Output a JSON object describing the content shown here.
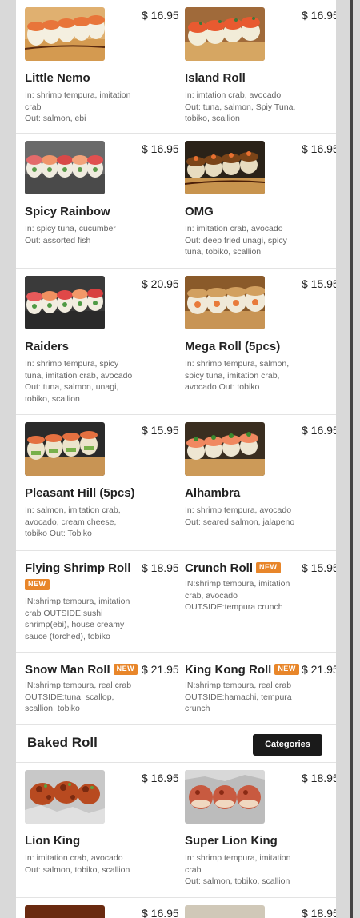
{
  "colors": {
    "badge": "#e8862a",
    "button": "#1a1a1a",
    "page_bg": "#d9d9d9",
    "panel_bg": "#ffffff"
  },
  "badge_label": "NEW",
  "rows1": [
    [
      {
        "name": "Little Nemo",
        "price": "$ 16.95",
        "desc": "In: shrimp tempura, imitation crab\nOut: salmon, ebi",
        "image": "roll-photo"
      },
      {
        "name": "Island Roll",
        "price": "$ 16.95",
        "desc": "In: imtation crab, avocado\nOut: tuna, salmon, Spiy Tuna, tobiko, scallion",
        "image": "roll-photo"
      }
    ],
    [
      {
        "name": "Spicy Rainbow",
        "price": "$ 16.95",
        "desc": "In: spicy tuna, cucumber\nOut: assorted fish",
        "image": "roll-photo"
      },
      {
        "name": "OMG",
        "price": "$ 16.95",
        "desc": "In: imitation crab, avocado\nOut: deep fried unagi, spicy tuna, tobiko, scallion",
        "image": "roll-photo"
      }
    ],
    [
      {
        "name": "Raiders",
        "price": "$ 20.95",
        "desc": "In: shrimp tempura, spicy tuna, imitation crab, avocado\nOut: tuna, salmon, unagi, tobiko, scallion",
        "image": "roll-photo"
      },
      {
        "name": "Mega Roll (5pcs)",
        "price": "$ 15.95",
        "desc": "In: shrimp tempura, salmon, spicy tuna, imitation crab, avocado Out: tobiko",
        "image": "roll-photo"
      }
    ],
    [
      {
        "name": "Pleasant Hill (5pcs)",
        "price": "$ 15.95",
        "desc": "In: salmon, imitation crab, avocado, cream cheese, tobiko Out: Tobiko",
        "image": "roll-photo"
      },
      {
        "name": "Alhambra",
        "price": "$ 16.95",
        "desc": "In: shrimp tempura, avocado\nOut: seared salmon, jalapeno",
        "image": "roll-photo"
      }
    ]
  ],
  "rows2": [
    [
      {
        "name": "Flying Shrimp Roll",
        "price": "$ 18.95",
        "desc": "IN:shrimp tempura, imitation crab OUTSIDE:sushi shrimp(ebi), house creamy sauce (torched), tobiko",
        "badge": true
      },
      {
        "name": "Crunch Roll",
        "price": "$ 15.95",
        "desc": "IN:shrimp tempura, imitation crab, avocado\nOUTSIDE:tempura crunch",
        "badge": true
      }
    ],
    [
      {
        "name": "Snow Man Roll",
        "price": "$ 21.95",
        "desc": "IN:shrimp tempura, real crab\nOUTSIDE:tuna, scallop, scallion, tobiko",
        "badge": true
      },
      {
        "name": "King Kong Roll",
        "price": "$ 21.95",
        "desc": "IN:shrimp tempura, real crab\nOUTSIDE:hamachi, tempura crunch",
        "badge": true
      }
    ]
  ],
  "section": {
    "title": "Baked Roll",
    "button": "Categories"
  },
  "rows3": [
    [
      {
        "name": "Lion King",
        "price": "$ 16.95",
        "desc": "In: imitation crab, avocado\nOut: salmon, tobiko, scallion",
        "image": "baked-roll-photo"
      },
      {
        "name": "Super Lion King",
        "price": "$ 18.95",
        "desc": "In: shrimp tempura, imitation crab\nOut: salmon, tobiko, scallion",
        "image": "baked-roll-photo"
      }
    ],
    [
      {
        "price": "$ 16.95",
        "image": "baked-roll-photo"
      },
      {
        "price": "$ 18.95",
        "image": "baked-roll-photo"
      }
    ]
  ]
}
